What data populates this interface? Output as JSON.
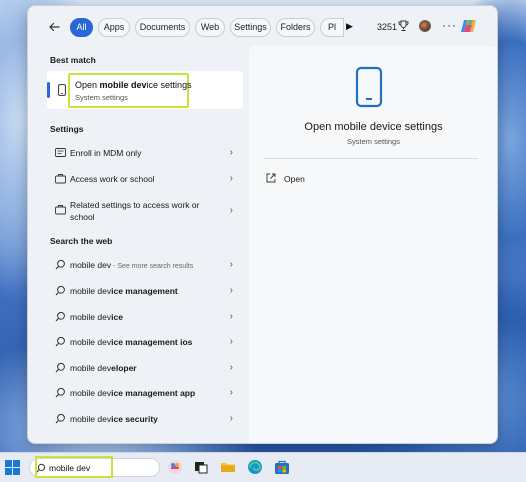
{
  "search_flyout": {
    "filters": [
      "All",
      "Apps",
      "Documents",
      "Web",
      "Settings",
      "Folders",
      "Pl"
    ],
    "more_filters_glyph": "▶",
    "points": "3251",
    "best_match_heading": "Best match",
    "best_match": {
      "title_prefix": "Open ",
      "title_bold": "mobile dev",
      "title_suffix": "ice settings",
      "subtitle": "System settings"
    },
    "settings_heading": "Settings",
    "settings_items": [
      "Enroll in MDM only",
      "Access work or school",
      "Related settings to access work or school"
    ],
    "web_heading": "Search the web",
    "web_items": [
      {
        "bold": "",
        "normal": "mobile dev",
        "hint": " - See more search results"
      },
      {
        "normal": "mobile dev",
        "bold": "ice management",
        "hint": ""
      },
      {
        "normal": "mobile dev",
        "bold": "ice",
        "hint": ""
      },
      {
        "normal": "mobile dev",
        "bold": "ice management ios",
        "hint": ""
      },
      {
        "normal": "mobile dev",
        "bold": "eloper",
        "hint": ""
      },
      {
        "normal": "mobile dev",
        "bold": "ice management app",
        "hint": ""
      },
      {
        "normal": "mobile dev",
        "bold": "ice security",
        "hint": ""
      }
    ],
    "preview": {
      "title": "Open mobile device settings",
      "subtitle": "System settings",
      "open_label": "Open"
    }
  },
  "taskbar": {
    "search_value": "mobile dev"
  },
  "colors": {
    "accent": "#2a67d6",
    "highlight": "#c6e43a"
  },
  "icons": [
    "back-arrow-icon",
    "trophy-icon",
    "avatar",
    "ellipsis-icon",
    "copilot-icon",
    "phone-icon",
    "list-icon",
    "briefcase-icon",
    "search-icon",
    "chevron-right-icon",
    "open-external-icon",
    "windows-logo-icon"
  ]
}
